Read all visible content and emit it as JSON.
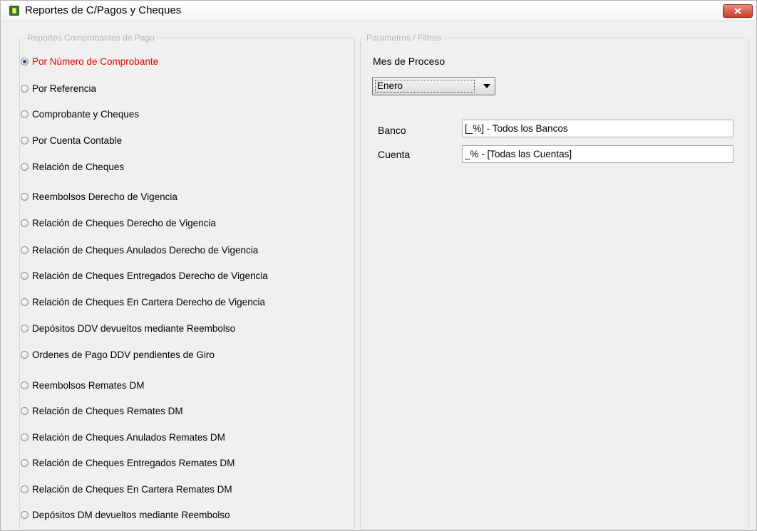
{
  "window": {
    "title": "Reportes de C/Pagos y Cheques",
    "icon": "app-icon",
    "close_icon": "close-icon"
  },
  "left_group": {
    "legend": "Reportes Comprobantes de Pago",
    "options": [
      {
        "label": "Por Número de Comprobante",
        "selected": true
      },
      {
        "label": "Por Referencia",
        "selected": false
      },
      {
        "label": "Comprobante y Cheques",
        "selected": false
      },
      {
        "label": "Por Cuenta Contable",
        "selected": false
      },
      {
        "label": "Relación de Cheques",
        "selected": false
      },
      {
        "label": "Reembolsos Derecho de Vigencia",
        "selected": false
      },
      {
        "label": "Relación de Cheques Derecho de Vigencia",
        "selected": false
      },
      {
        "label": "Relación de Cheques Anulados Derecho de Vigencia",
        "selected": false
      },
      {
        "label": "Relación de Cheques Entregados Derecho de Vigencia",
        "selected": false
      },
      {
        "label": "Relación de Cheques En Cartera Derecho de Vigencia",
        "selected": false
      },
      {
        "label": "Depósitos DDV devueltos mediante Reembolso",
        "selected": false
      },
      {
        "label": "Ordenes de Pago DDV pendientes de Giro",
        "selected": false
      },
      {
        "label": "Reembolsos Remates DM",
        "selected": false
      },
      {
        "label": "Relación de Cheques Remates DM",
        "selected": false
      },
      {
        "label": "Relación de Cheques Anulados Remates DM",
        "selected": false
      },
      {
        "label": "Relación de Cheques Entregados Remates DM",
        "selected": false
      },
      {
        "label": "Relación de Cheques En Cartera Remates DM",
        "selected": false
      },
      {
        "label": "Depósitos DM devueltos mediante Reembolso",
        "selected": false
      }
    ]
  },
  "right_group": {
    "legend": "Parametros / Filtros",
    "mes_label": "Mes de Proceso",
    "mes_value": "Enero",
    "banco_label": "Banco",
    "banco_value": "[_%] - Todos los Bancos",
    "cuenta_label": "Cuenta",
    "cuenta_value": "_% - [Todas las Cuentas]"
  },
  "colors": {
    "selected_text": "#e60000",
    "close_button": "#c4402a"
  }
}
